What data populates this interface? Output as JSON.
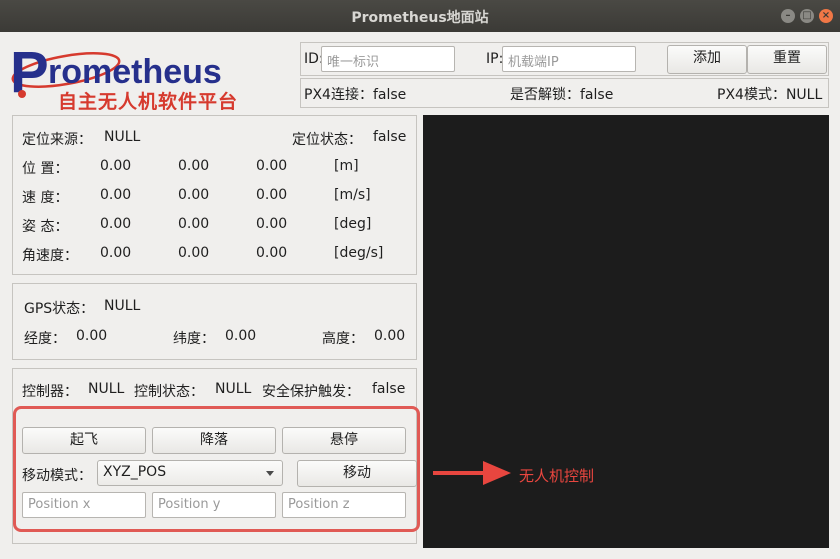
{
  "window": {
    "title": "Prometheus地面站"
  },
  "logo": {
    "name": "Prometheus",
    "subtitle": "自主无人机软件平台"
  },
  "connection": {
    "id_label": "ID:",
    "id_placeholder": "唯一标识",
    "ip_label": "IP:",
    "ip_placeholder": "机载端IP",
    "add_button": "添加",
    "reset_button": "重置",
    "px4_connect": "PX4连接：false",
    "unlocked": "是否解锁：false",
    "px4_mode": "PX4模式：NULL"
  },
  "state": {
    "source_label": "定位来源：",
    "source_value": "NULL",
    "status_label": "定位状态：",
    "status_value": "false",
    "rows": [
      {
        "label": "位  置：",
        "x": "0.00",
        "y": "0.00",
        "z": "0.00",
        "unit": "[m]"
      },
      {
        "label": "速  度：",
        "x": "0.00",
        "y": "0.00",
        "z": "0.00",
        "unit": "[m/s]"
      },
      {
        "label": "姿  态：",
        "x": "0.00",
        "y": "0.00",
        "z": "0.00",
        "unit": "[deg]"
      },
      {
        "label": "角速度：",
        "x": "0.00",
        "y": "0.00",
        "z": "0.00",
        "unit": "[deg/s]"
      }
    ]
  },
  "gps": {
    "status_label": "GPS状态：",
    "status_value": "NULL",
    "lon_label": "经度：",
    "lon_value": "0.00",
    "lat_label": "纬度：",
    "lat_value": "0.00",
    "alt_label": "高度：",
    "alt_value": "0.00"
  },
  "control": {
    "controller_label": "控制器：",
    "controller_value": "NULL",
    "ctrl_status_label": "控制状态：",
    "ctrl_status_value": "NULL",
    "safety_label": "安全保护触发：",
    "safety_value": "false",
    "takeoff": "起飞",
    "land": "降落",
    "hover": "悬停",
    "mode_label": "移动模式：",
    "mode_value": "XYZ_POS",
    "move": "移动",
    "px_placeholder": "Position x",
    "py_placeholder": "Position y",
    "pz_placeholder": "Position z"
  },
  "annotation": {
    "text": "无人机控制",
    "color": "#e8463f"
  }
}
